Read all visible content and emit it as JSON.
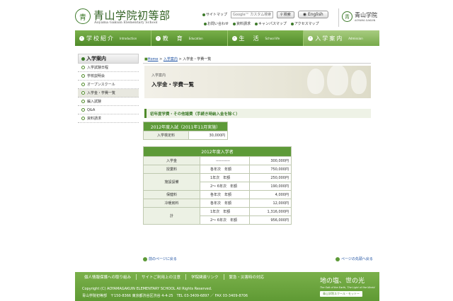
{
  "header": {
    "logo_mark": "青",
    "logo_jp": "青山学院初等部",
    "logo_en": "Aoyama Gakuin Elementary School",
    "sitemap": "サイトマップ",
    "search_placeholder": "Google™ カスタム検索",
    "search_button": "検索",
    "english_button": "English",
    "util_links": [
      "お問い合わせ",
      "資料請求",
      "キャンパスマップ",
      "アクセスマップ"
    ],
    "brand_jp": "青山学院",
    "brand_en": "AOYAMA GAKUIN",
    "brand_mark": "青"
  },
  "nav": [
    {
      "jp": "学校紹介",
      "en": "Introduction"
    },
    {
      "jp": "教　育",
      "en": "Education"
    },
    {
      "jp": "生　活",
      "en": "School life"
    },
    {
      "jp": "入学案内",
      "en": "Admission"
    }
  ],
  "sidebar": {
    "title": "入学案内",
    "items": [
      {
        "label": "入学試験日程"
      },
      {
        "label": "学校説明会"
      },
      {
        "label": "オープンスクール"
      },
      {
        "label": "入学金・学費一覧"
      },
      {
        "label": "編入試験"
      },
      {
        "label": "Q&A"
      },
      {
        "label": "資料請求"
      }
    ]
  },
  "breadcrumb": {
    "home": "Home",
    "sep1": " > ",
    "section": "入学案内",
    "sep2": " > ",
    "current": "入学金・学費一覧"
  },
  "banner": {
    "category": "入学案内",
    "title": "入学金・学費一覧"
  },
  "section_heading": "初年度学費・その他諸費（手続き時納入金を除く）",
  "exam_table": {
    "caption": "2012年度入試（2011年11月実施）",
    "rows": [
      {
        "label": "入学検定料",
        "value": "30,000円"
      }
    ]
  },
  "fee_table": {
    "caption": "2012年度入学者",
    "rows": [
      {
        "label": "入学金",
        "mid": "-----------",
        "value": "300,000円"
      },
      {
        "label": "授業料",
        "mid": "各年次　年額",
        "value": "750,000円"
      },
      {
        "label": "施設設備",
        "mid": "1年次　年額",
        "value": "250,000円"
      },
      {
        "label": "",
        "mid": "2～ 6年次　年額",
        "value": "190,000円"
      },
      {
        "label": "保健料",
        "mid": "各年次　年額",
        "value": "4,000円"
      },
      {
        "label": "冷暖房料",
        "mid": "各年次　年額",
        "value": "12,000円"
      },
      {
        "label": "計",
        "mid": "1年次　年額",
        "value": "1,316,000円"
      },
      {
        "label": "",
        "mid": "2～ 6年次　年額",
        "value": "956,000円"
      }
    ]
  },
  "page_links": {
    "prev": "前のページに戻る",
    "top": "ページの先頭へ戻る"
  },
  "footer": {
    "links": [
      "個人情報保護への取り組み",
      "サイトご利用上の注意",
      "学院関連リンク",
      "緊急・災害時の対応"
    ],
    "copyright": "Copyright (C) AOYAMAGAKUIN ELEMENTARY SCHOOL All Rights Reserved.",
    "address": "青山学院初等部　〒150-8366 東京都渋谷区渋谷 4-4-25　TEL 03-3409-6897 ／ FAX 03-3409-8706",
    "motto_jp": "地の塩、世の光",
    "motto_en": "The Salt of the Earth, The Light of the World",
    "motto_badge": "青山学院スクール・モットー"
  },
  "colors": {
    "accent": "#4f8a2a",
    "table_header": "#5d9a38",
    "link": "#1a4ea0"
  }
}
